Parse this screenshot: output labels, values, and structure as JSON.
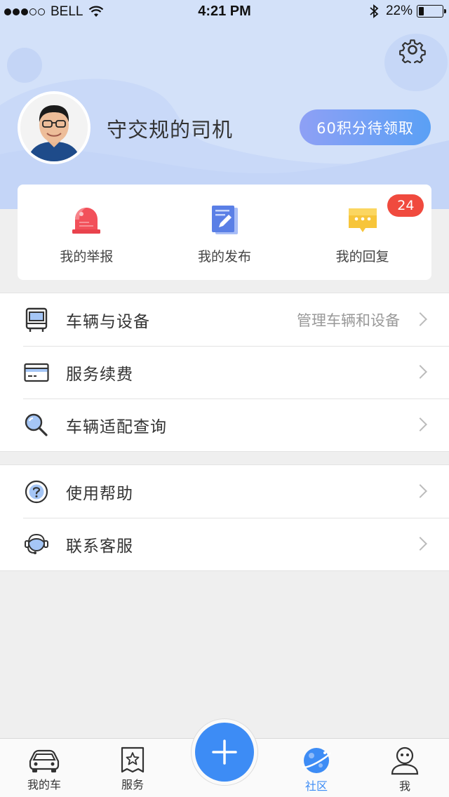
{
  "status_bar": {
    "carrier": "BELL",
    "time": "4:21 PM",
    "battery": "22%",
    "battery_level": 0.22,
    "signal_bars": 3,
    "signal_total": 5
  },
  "profile": {
    "username": "守交规的司机",
    "points_button": "60积分待领取"
  },
  "quick_actions": [
    {
      "label": "我的举报",
      "icon": "alarm-light-icon"
    },
    {
      "label": "我的发布",
      "icon": "notebook-edit-icon"
    },
    {
      "label": "我的回复",
      "icon": "chat-bubble-icon",
      "badge": "24"
    }
  ],
  "menu_group_1": [
    {
      "label": "车辆与设备",
      "hint": "管理车辆和设备",
      "icon": "bus-icon"
    },
    {
      "label": "服务续费",
      "hint": "",
      "icon": "credit-card-icon"
    },
    {
      "label": "车辆适配查询",
      "hint": "",
      "icon": "magnifier-icon"
    }
  ],
  "menu_group_2": [
    {
      "label": "使用帮助",
      "hint": "",
      "icon": "question-circle-icon"
    },
    {
      "label": "联系客服",
      "hint": "",
      "icon": "headset-agent-icon"
    }
  ],
  "tabbar": {
    "tabs": [
      {
        "label": "我的车",
        "icon": "car-icon",
        "active": false
      },
      {
        "label": "服务",
        "icon": "receipt-star-icon",
        "active": false
      },
      {
        "label": "社区",
        "icon": "planet-icon",
        "active": true
      },
      {
        "label": "我",
        "icon": "person-icon",
        "active": false
      }
    ],
    "fab_icon": "plus-icon"
  },
  "colors": {
    "accent": "#3d8cf5",
    "header_bg": "#d3e1f9",
    "badge": "#f04a3e"
  }
}
